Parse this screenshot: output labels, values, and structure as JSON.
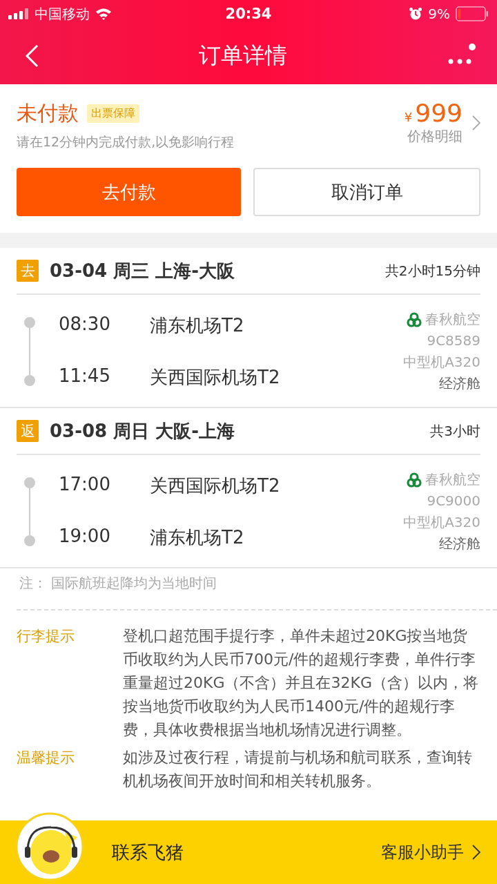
{
  "status_bar": {
    "carrier": "中国移动",
    "time": "20:34",
    "battery": "9%"
  },
  "nav": {
    "title": "订单详情"
  },
  "order": {
    "status": "未付款",
    "badge": "出票保障",
    "notice": "请在12分钟内完成付款,以免影响行程",
    "currency": "¥",
    "price": "999",
    "price_link": "价格明细",
    "buttons": [
      {
        "label": "去付款",
        "kind": "primary"
      },
      {
        "label": "取消订单",
        "kind": "secondary"
      }
    ]
  },
  "legs": [
    {
      "tag": "去",
      "title": "03-04 周三 上海-大阪",
      "duration": "共2小时15分钟",
      "depart_time": "08:30",
      "depart_airport": "浦东机场T2",
      "arrive_time": "11:45",
      "arrive_airport": "关西国际机场T2",
      "airline": "春秋航空",
      "flight_no": "9C8589",
      "aircraft": "中型机A320",
      "cabin": "经济舱"
    },
    {
      "tag": "返",
      "title": "03-08 周日 大阪-上海",
      "duration": "共3小时",
      "depart_time": "17:00",
      "depart_airport": "关西国际机场T2",
      "arrive_time": "19:00",
      "arrive_airport": "浦东机场T2",
      "airline": "春秋航空",
      "flight_no": "9C9000",
      "aircraft": "中型机A320",
      "cabin": "经济舱"
    }
  ],
  "note": "注：  国际航班起降均为当地时间",
  "tips": [
    {
      "label": "行李提示",
      "text": "登机口超范围手提行李，单件未超过20KG按当地货币收取约为人民币700元/件的超规行李费，单件行李重量超过20KG（不含）并且在32KG（含）以内，将按当地货币收取约为人民币1400元/件的超规行李费，具体收费根据当地机场情况进行调整。"
    },
    {
      "label": "温馨提示",
      "text": "如涉及过夜行程，请提前与机场和航司联系，查询转机机场夜间开放时间和相关转机服务。"
    }
  ],
  "contact_bar": {
    "title": "联系飞猪",
    "link": "客服小助手"
  }
}
